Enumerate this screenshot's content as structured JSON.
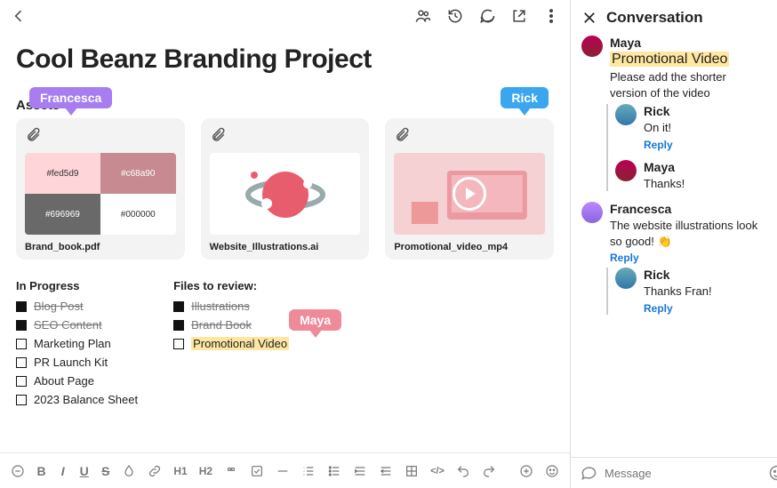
{
  "header": {
    "title": "Conversation"
  },
  "page": {
    "title": "Cool Beanz Branding Project"
  },
  "sections": {
    "assets": "Assets",
    "in_progress": "In Progress",
    "review": "Files to review:"
  },
  "cursors": {
    "francesca": "Francesca",
    "rick": "Rick",
    "maya": "Maya"
  },
  "assets": [
    {
      "caption": "Brand_book.pdf",
      "swatches": [
        "#fed5d9",
        "#c68a90",
        "#696969",
        "#000000"
      ]
    },
    {
      "caption": "Website_Illustrations.ai"
    },
    {
      "caption": "Promotional_video_mp4"
    }
  ],
  "in_progress": [
    {
      "label": "Blog Post",
      "done": true
    },
    {
      "label": "SEO Content",
      "done": true
    },
    {
      "label": "Marketing Plan",
      "done": false
    },
    {
      "label": "PR Launch Kit",
      "done": false
    },
    {
      "label": "About Page",
      "done": false
    },
    {
      "label": "2023 Balance Sheet",
      "done": false
    }
  ],
  "review": [
    {
      "label": "Illustrations",
      "done": true
    },
    {
      "label": "Brand Book",
      "done": true
    },
    {
      "label": "Promotional Video",
      "done": false,
      "highlight": true
    }
  ],
  "conversation": {
    "threads": [
      {
        "author": "Maya",
        "avatar": "maya",
        "highlight": "Promotional Video",
        "text": "Please add the shorter version of the video",
        "replies": [
          {
            "author": "Rick",
            "avatar": "rick",
            "text": "On it!",
            "reply_link": "Reply"
          },
          {
            "author": "Maya",
            "avatar": "maya",
            "text": "Thanks!"
          }
        ]
      },
      {
        "author": "Francesca",
        "avatar": "fran",
        "text": "The website illustrations look so good! 👏",
        "reply_link": "Reply",
        "replies": [
          {
            "author": "Rick",
            "avatar": "rick",
            "text": "Thanks Fran!",
            "reply_link": "Reply"
          }
        ]
      }
    ]
  },
  "input": {
    "placeholder": "Message"
  },
  "toolbar_labels": {
    "b": "B",
    "i": "I",
    "u": "U",
    "s": "S",
    "h1": "H1",
    "h2": "H2",
    "code": "</>"
  }
}
